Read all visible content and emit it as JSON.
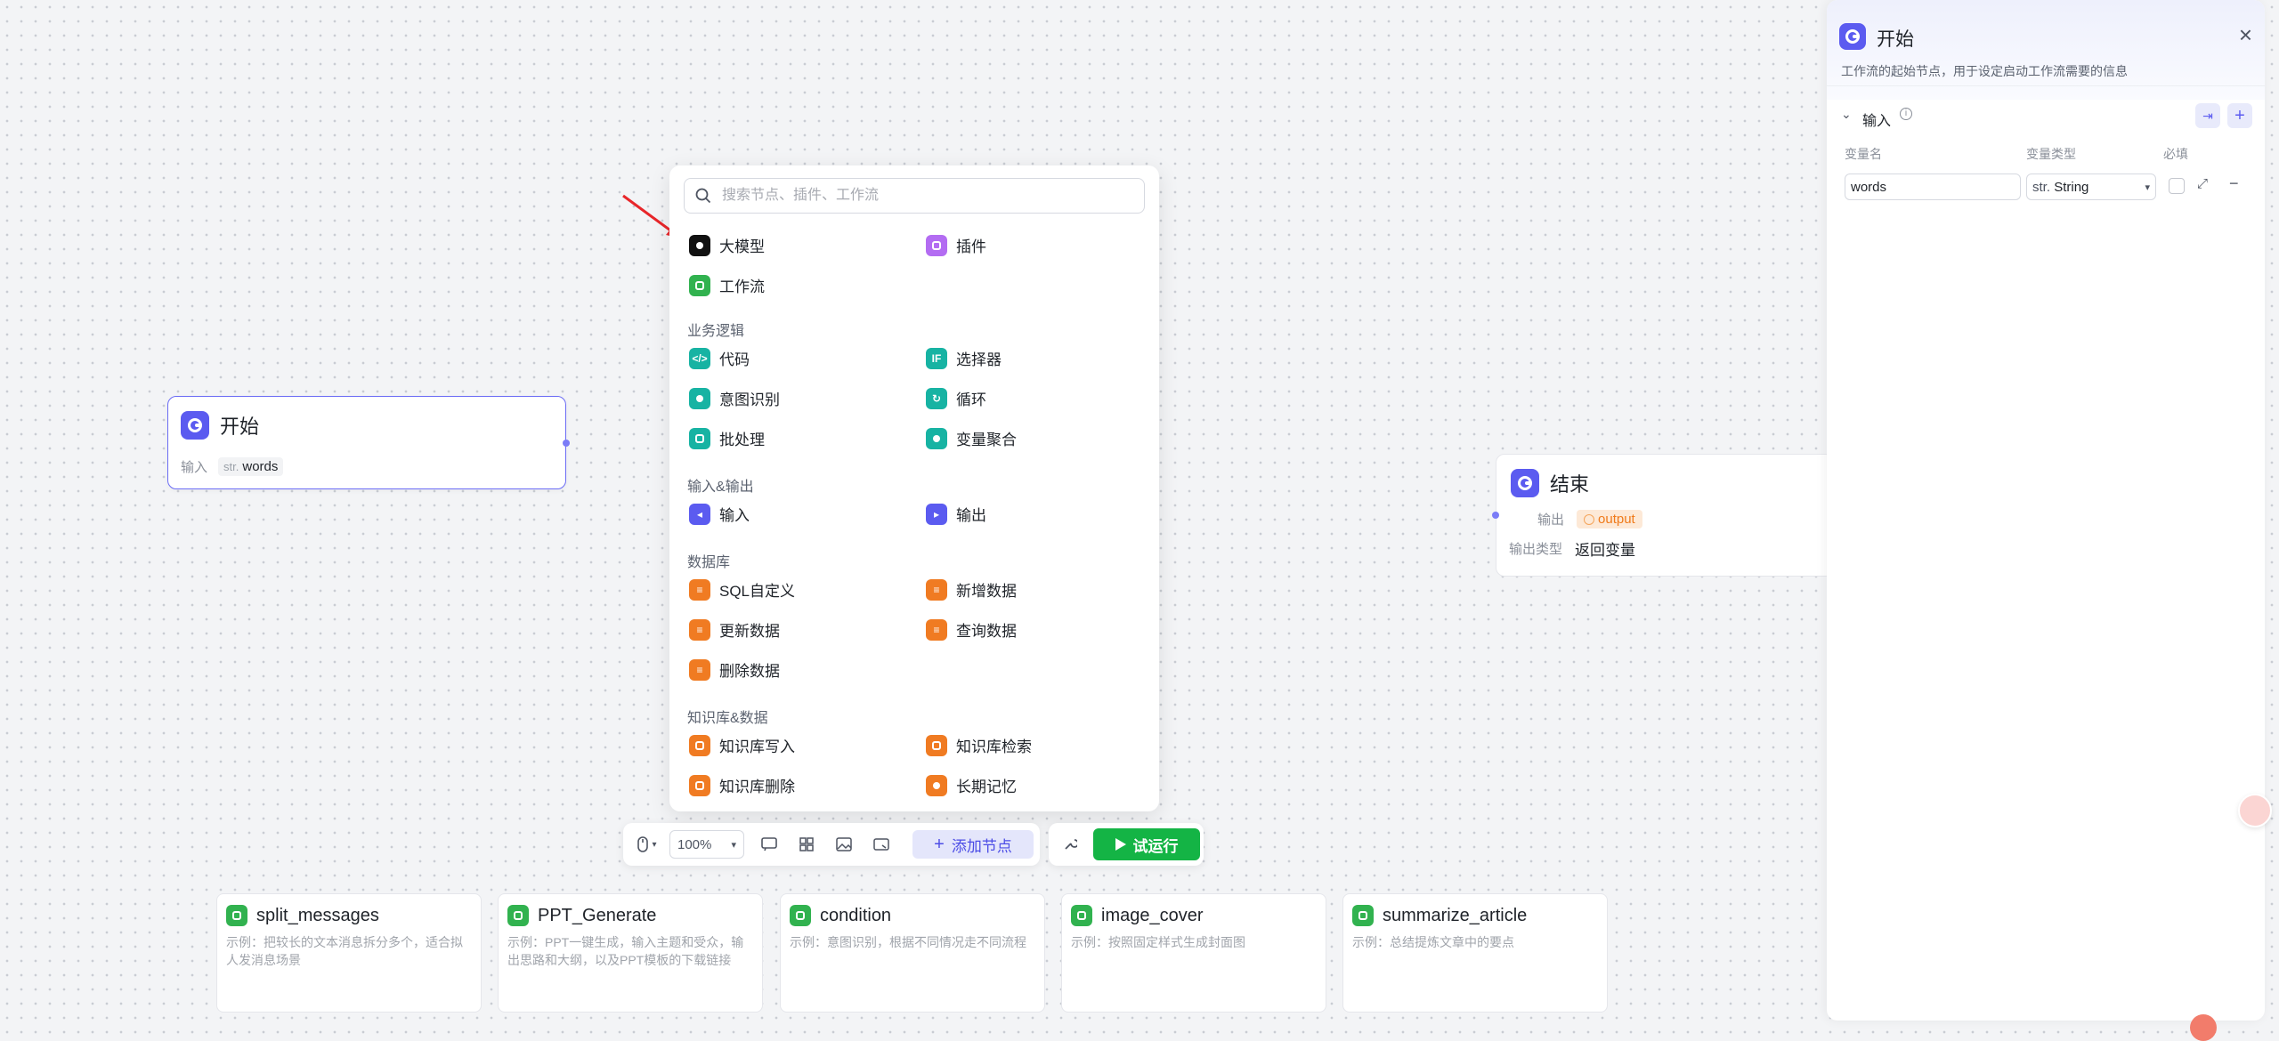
{
  "canvas": {
    "start_node": {
      "title": "开始",
      "input_label": "输入",
      "var_type": "str.",
      "var_name": "words"
    },
    "end_node": {
      "title": "结束",
      "output_label": "输出",
      "output_var": "output",
      "output_type_label": "输出类型",
      "output_type_value": "返回变量"
    }
  },
  "node_popup": {
    "search_placeholder": "搜索节点、插件、工作流",
    "top_items": [
      "大模型",
      "插件",
      "工作流"
    ],
    "sections": [
      {
        "label": "业务逻辑",
        "items": [
          "代码",
          "选择器",
          "意图识别",
          "循环",
          "批处理",
          "变量聚合"
        ]
      },
      {
        "label": "输入&输出",
        "items": [
          "输入",
          "输出"
        ]
      },
      {
        "label": "数据库",
        "items": [
          "SQL自定义",
          "新增数据",
          "更新数据",
          "查询数据",
          "删除数据"
        ]
      },
      {
        "label": "知识库&数据",
        "items": [
          "知识库写入",
          "知识库检索",
          "知识库删除",
          "长期记忆"
        ]
      }
    ],
    "icons": {
      "llm": "llm-icon",
      "plugin": "plugin-icon",
      "workflow": "workflow-icon",
      "code": "code-icon",
      "selector": "if-icon",
      "intent": "intent-icon",
      "loop": "loop-icon",
      "batch": "batch-icon",
      "aggregate": "aggregate-icon",
      "input": "input-icon",
      "output": "output-icon",
      "database": "database-icon",
      "knowledge": "knowledge-icon",
      "memory": "memory-icon"
    }
  },
  "toolbar": {
    "zoom": "100%",
    "add_node_label": "添加节点",
    "run_label": "试运行"
  },
  "templates": [
    {
      "name": "split_messages",
      "desc": "示例：把较长的文本消息拆分多个，适合拟人发消息场景"
    },
    {
      "name": "PPT_Generate",
      "desc": "示例：PPT一键生成，输入主题和受众，输出思路和大纲，以及PPT模板的下载链接"
    },
    {
      "name": "condition",
      "desc": "示例：意图识别，根据不同情况走不同流程"
    },
    {
      "name": "image_cover",
      "desc": "示例：按照固定样式生成封面图"
    },
    {
      "name": "summarize_article",
      "desc": "示例：总结提炼文章中的要点"
    }
  ],
  "side_panel": {
    "title": "开始",
    "description": "工作流的起始节点，用于设定启动工作流需要的信息",
    "section_title": "输入",
    "col_name": "变量名",
    "col_type": "变量类型",
    "col_required": "必填",
    "row": {
      "name": "words",
      "type": "String",
      "type_prefix": "str."
    }
  },
  "colors": {
    "brand": "#5b5bf0",
    "run_green": "#14b445",
    "orange": "#f07b22",
    "teal": "#17b3a3"
  }
}
